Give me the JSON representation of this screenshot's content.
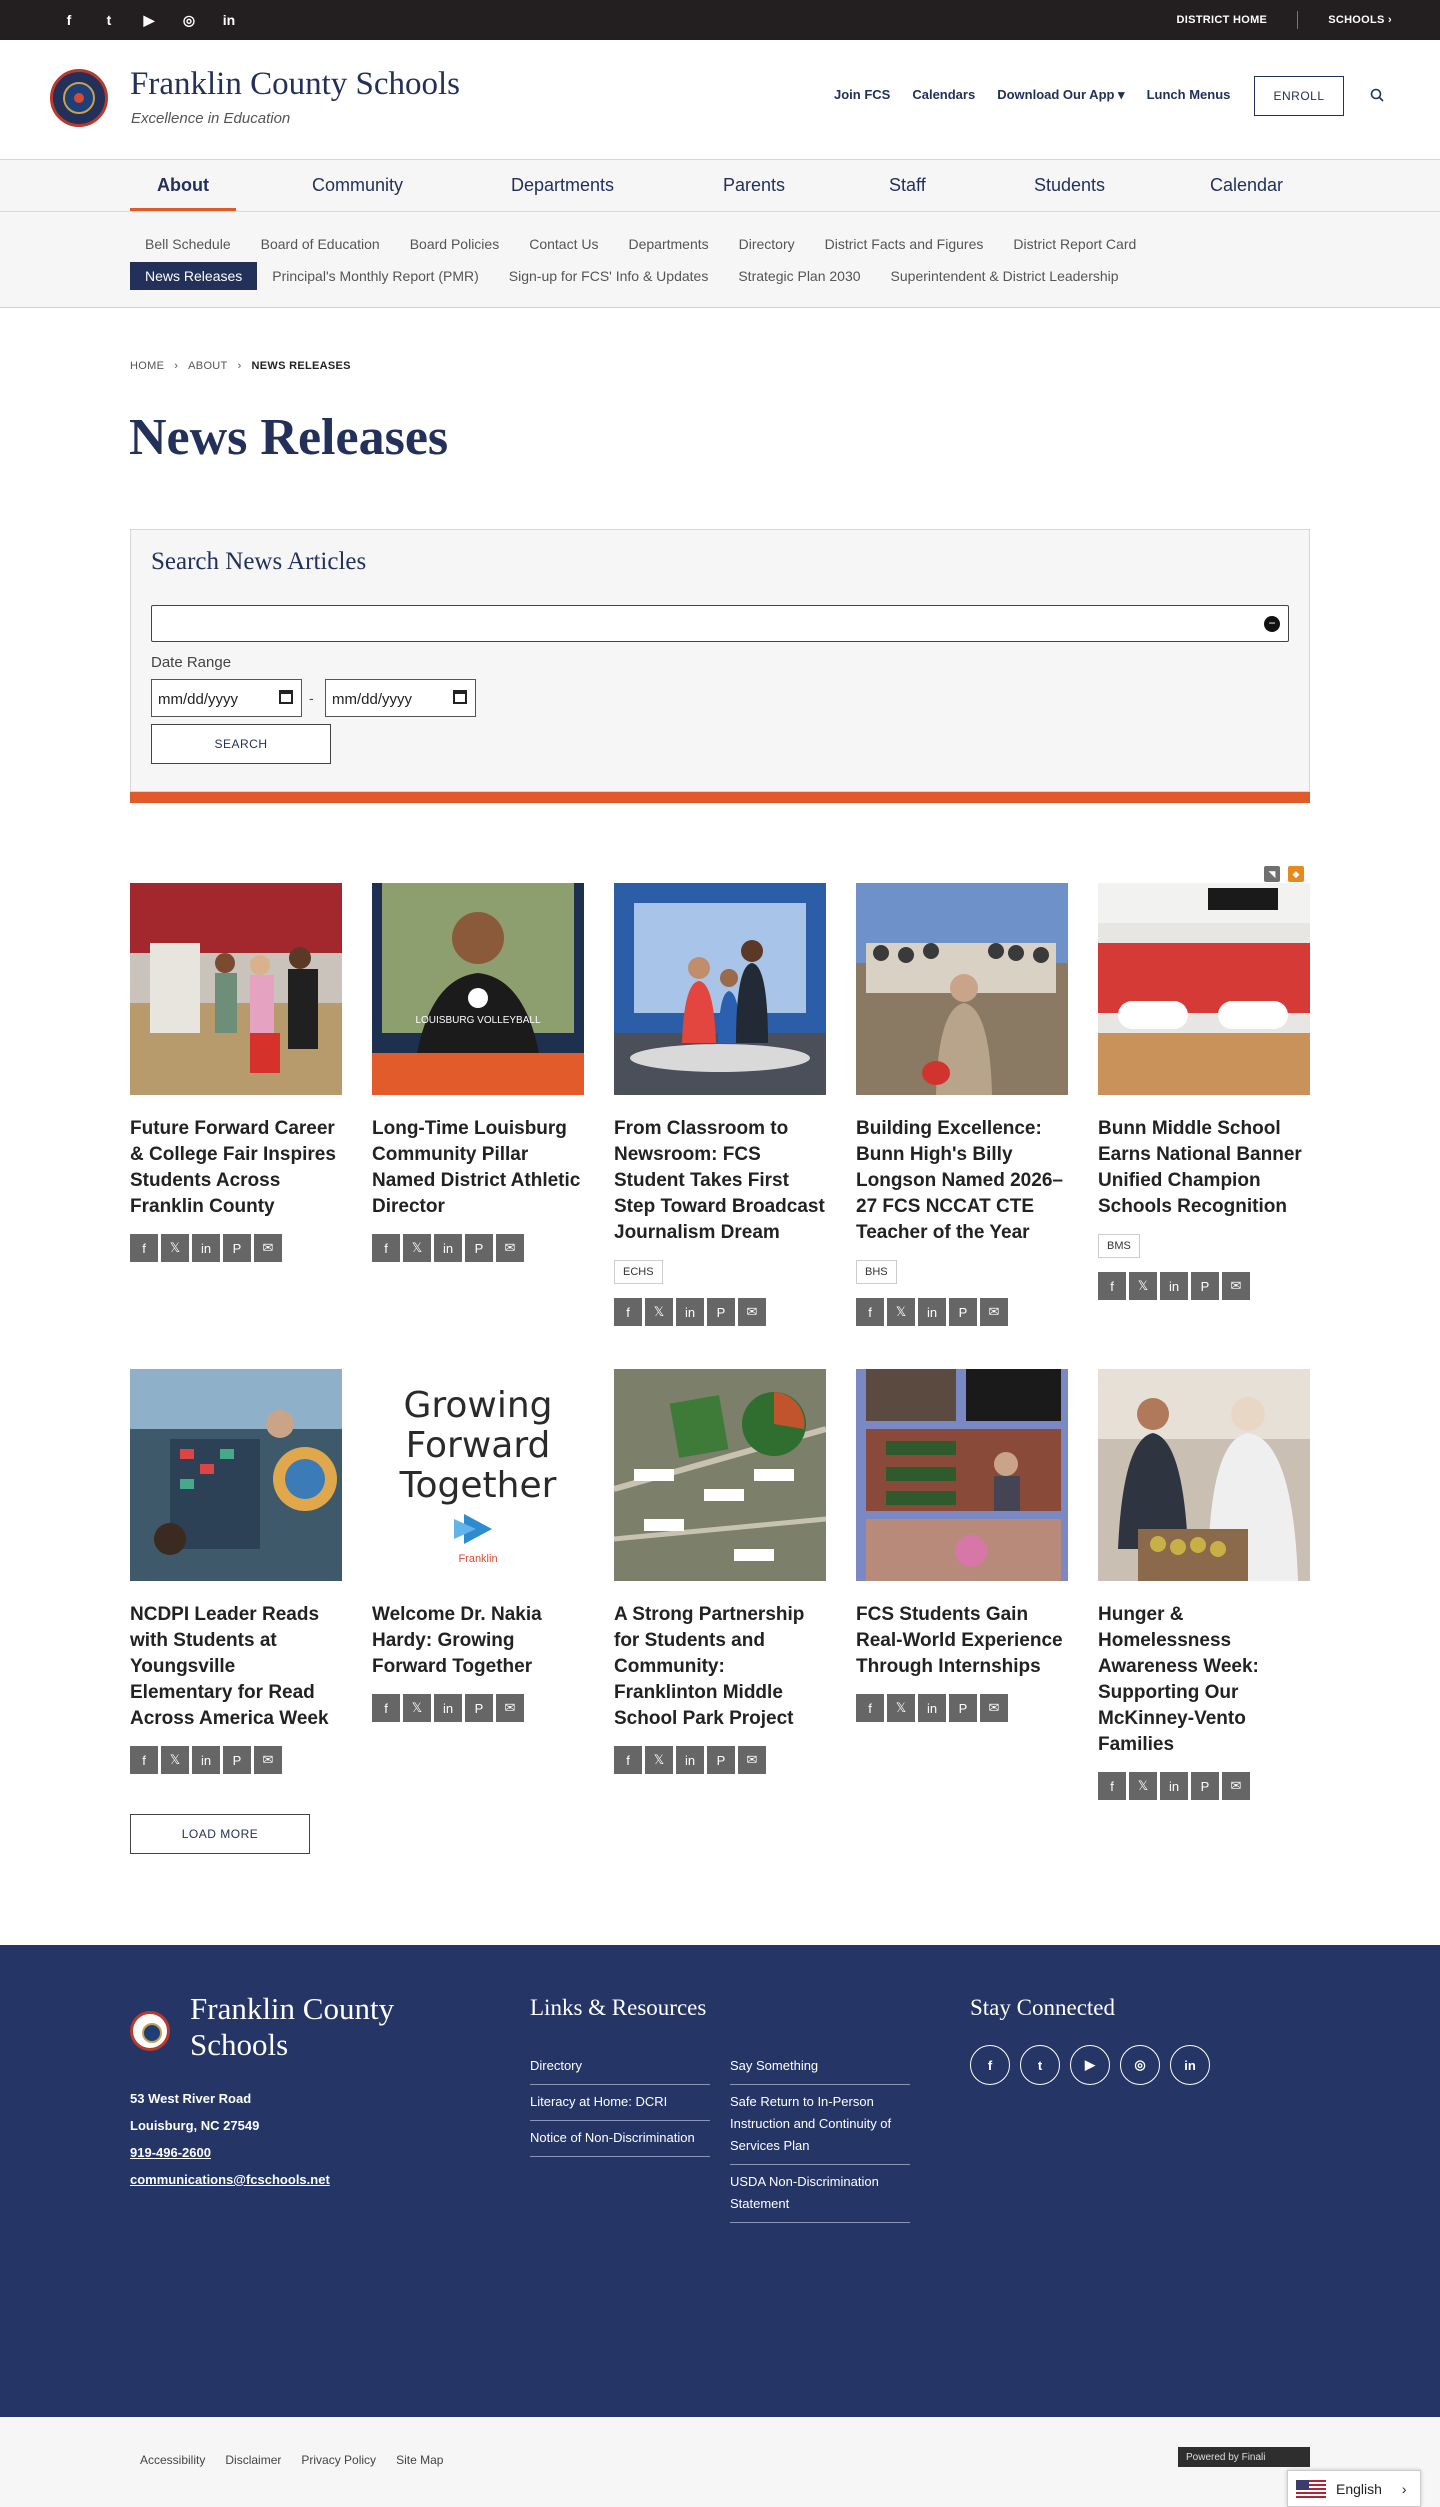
{
  "topbar": {
    "social": [
      "f",
      "t",
      "▶",
      "◎",
      "in"
    ],
    "district_home": "DISTRICT HOME",
    "schools": "SCHOOLS ›"
  },
  "header": {
    "site_name": "Franklin County Schools",
    "tagline": "Excellence in Education",
    "links": [
      "Join FCS",
      "Calendars",
      "Download Our App ▾",
      "Lunch Menus"
    ],
    "enroll": "ENROLL"
  },
  "main_nav": [
    "About",
    "Community",
    "Departments",
    "Parents",
    "Staff",
    "Students",
    "Calendar"
  ],
  "sub_nav": {
    "row1": [
      "Bell Schedule",
      "Board of Education",
      "Board Policies",
      "Contact Us",
      "Departments",
      "Directory",
      "District Facts and Figures",
      "District Report Card"
    ],
    "row2": [
      "News Releases",
      "Principal's Monthly Report (PMR)",
      "Sign-up for FCS' Info & Updates",
      "Strategic Plan 2030",
      "Superintendent & District Leadership"
    ]
  },
  "breadcrumb": [
    "HOME",
    "ABOUT",
    "NEWS RELEASES"
  ],
  "page_title": "News Releases",
  "search": {
    "title": "Search News Articles",
    "date_range_label": "Date Range",
    "date_from": "mm/dd/yyyy",
    "date_to": "mm/dd/yyyy",
    "separator": "-",
    "button": "SEARCH"
  },
  "share_icons": [
    "f",
    "𝕏",
    "in",
    "P",
    "✉"
  ],
  "articles": [
    {
      "title": "Future Forward Career & College Fair Inspires Students Across Franklin County",
      "tag": ""
    },
    {
      "title": "Long-Time Louisburg Community Pillar Named District Athletic Director",
      "tag": ""
    },
    {
      "title": "From Classroom to Newsroom: FCS Student Takes First Step Toward Broadcast Journalism Dream",
      "tag": "ECHS"
    },
    {
      "title": "Building Excellence: Bunn High's Billy Longson Named 2026–27 FCS NCCAT CTE Teacher of the Year",
      "tag": "BHS"
    },
    {
      "title": "Bunn Middle School Earns National Banner Unified Champion Schools Recognition",
      "tag": "BMS"
    },
    {
      "title": "NCDPI Leader Reads with Students at Youngsville Elementary for Read Across America Week",
      "tag": ""
    },
    {
      "title": "Welcome Dr. Nakia Hardy: Growing Forward Together",
      "tag": ""
    },
    {
      "title": "A Strong Partnership for Students and Community: Franklinton Middle School Park Project",
      "tag": ""
    },
    {
      "title": "FCS Students Gain Real-World Experience Through Internships",
      "tag": ""
    },
    {
      "title": "Hunger & Homelessness Awareness Week: Supporting Our McKinney-Vento Families",
      "tag": ""
    }
  ],
  "image_text": {
    "volleyball": "LOUISBURG VOLLEYBALL",
    "growing": [
      "Growing",
      "Forward",
      "Together"
    ],
    "franklin": "Franklin"
  },
  "load_more": "LOAD MORE",
  "footer": {
    "name": "Franklin County Schools",
    "address1": "53 West River Road",
    "address2": "Louisburg, NC  27549",
    "phone": "919-496-2600",
    "email": "communications@fcschools.net",
    "links_heading": "Links & Resources",
    "links_col1": [
      "Directory",
      "Literacy at Home: DCRI",
      "Notice of Non-Discrimination"
    ],
    "links_col2": [
      "Say Something",
      "Safe Return to In-Person Instruction and Continuity of Services Plan",
      "USDA Non-Discrimination Statement"
    ],
    "stay_heading": "Stay Connected",
    "social": [
      "f",
      "t",
      "▶",
      "◎",
      "in"
    ]
  },
  "bottom": {
    "links": [
      "Accessibility",
      "Disclaimer",
      "Privacy Policy",
      "Site Map"
    ],
    "powered": "Powered by Finali",
    "language": "English"
  },
  "colors": {
    "navy": "#23305a",
    "accent": "#e15a2c",
    "footer": "#253566"
  }
}
